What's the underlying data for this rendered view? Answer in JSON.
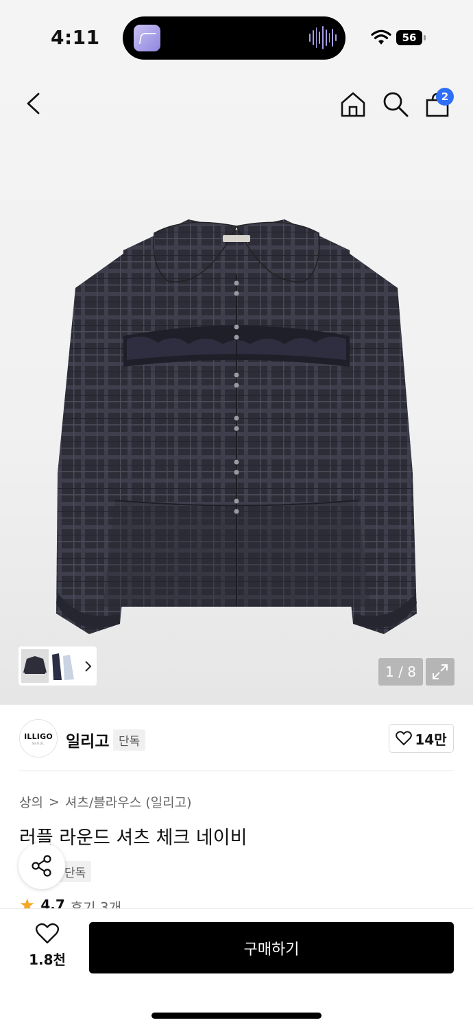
{
  "status_bar": {
    "time": "4:11",
    "battery": "56"
  },
  "gallery": {
    "counter": "1 / 8"
  },
  "header": {
    "cart_count": "2"
  },
  "brand": {
    "logo_line1": "ILLIGO",
    "logo_line2": "SEOUL",
    "name": "일리고",
    "exclusive_tag": "단독",
    "likes": "14만"
  },
  "product": {
    "breadcrumb": [
      "상의",
      "셔츠/블라우스 (일리고)"
    ],
    "breadcrumb_sep": ">",
    "title": "러플 라운드 셔츠 체크 네이비",
    "exclusive_tag": "단독",
    "rating": "4.7",
    "reviews": "후기 3개"
  },
  "bottom_bar": {
    "wish_count": "1.8천",
    "buy_label": "구매하기"
  },
  "colors": {
    "accent_badge": "#2f6ef6",
    "buy_button": "#000000",
    "star": "#f5a623"
  }
}
